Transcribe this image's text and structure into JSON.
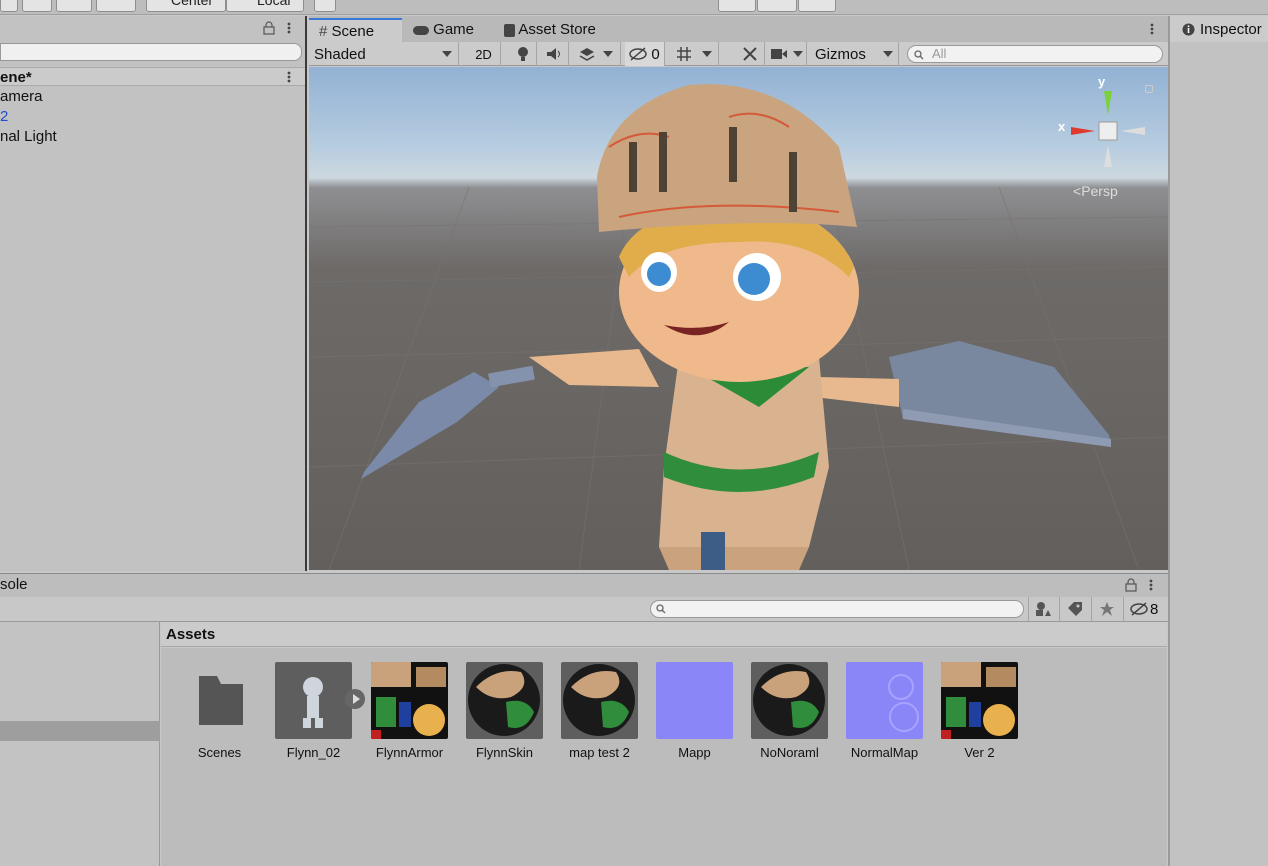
{
  "toolbar": {
    "center_label": "Center",
    "local_label": "Local"
  },
  "hierarchy": {
    "scene_name": "ene*",
    "items": [
      {
        "label": "amera"
      },
      {
        "label": "2"
      },
      {
        "label": "nal Light"
      }
    ]
  },
  "scene_view": {
    "tabs": [
      {
        "label": "Scene",
        "icon": "grid-icon"
      },
      {
        "label": "Game",
        "icon": "gamepad-icon"
      },
      {
        "label": "Asset Store",
        "icon": "bag-icon"
      }
    ],
    "shading_mode": "Shaded",
    "mode_2d_label": "2D",
    "hidden_count": "0",
    "gizmos_label": "Gizmos",
    "search_placeholder": "All",
    "gizmo": {
      "y_label": "y",
      "x_label": "x",
      "projection_label": "Persp"
    }
  },
  "bottom": {
    "console_tab": "sole",
    "hidden_count": "8",
    "assets_header": "Assets",
    "assets": [
      {
        "label": "Scenes",
        "type": "folder"
      },
      {
        "label": "Flynn_02",
        "type": "model"
      },
      {
        "label": "FlynnArmor",
        "type": "texture"
      },
      {
        "label": "FlynnSkin",
        "type": "material"
      },
      {
        "label": "map test 2",
        "type": "material"
      },
      {
        "label": "Mapp",
        "type": "normal"
      },
      {
        "label": "NoNoraml",
        "type": "material"
      },
      {
        "label": "NormalMap",
        "type": "normal"
      },
      {
        "label": "Ver 2",
        "type": "texture"
      }
    ]
  },
  "inspector": {
    "title": "Inspector"
  },
  "colors": {
    "accent": "#3a79d6",
    "link_blue": "#1c4fcf",
    "normal_map": "#8b86f7"
  }
}
